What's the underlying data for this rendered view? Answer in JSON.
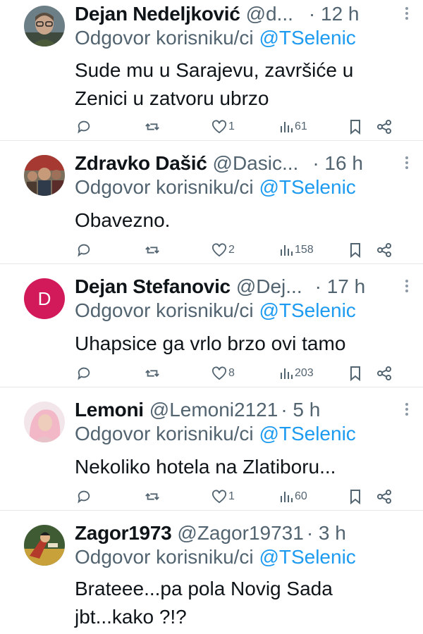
{
  "reply_prefix": "Odgovor korisniku/ci",
  "reply_mention": "@TSelenic",
  "tweets": [
    {
      "name": "Dejan Nedeljković",
      "handle": "@d...",
      "time": "· 12 h",
      "text_lines": [
        "Sude mu u Sarajevu, završiće u",
        "Zenici u zatvoru ubrzo"
      ],
      "likes": "1",
      "views": "61",
      "avatar": "photo-man-glasses"
    },
    {
      "name": "Zdravko Dašić",
      "handle": "@Dasic...",
      "time": "· 16 h",
      "text_lines": [
        "Obavezno."
      ],
      "likes": "2",
      "views": "158",
      "avatar": "photo-crowd"
    },
    {
      "name": "Dejan Stefanovic",
      "handle": "@Dej...",
      "time": "· 17 h",
      "text_lines": [
        "Uhapsice ga vrlo brzo ovi tamo"
      ],
      "likes": "8",
      "views": "203",
      "avatar_letter": "D",
      "avatar_color": "#d2195a"
    },
    {
      "name": "Lemoni",
      "handle": "@Lemoni2121",
      "time": "· 5 h",
      "text_lines": [
        "Nekoliko hotela na Zlatiboru..."
      ],
      "likes": "1",
      "views": "60",
      "avatar": "photo-woman-pink"
    },
    {
      "name": "Zagor1973",
      "handle": "@Zagor19731",
      "time": "· 3 h",
      "text_lines": [
        "Brateee...pa pola Novig Sada",
        "jbt...kako ?!?"
      ],
      "avatar": "comic-hero"
    }
  ],
  "colors": {
    "mention": "#1d9bf0",
    "secondary": "#536471",
    "divider": "#e6e8ea"
  }
}
